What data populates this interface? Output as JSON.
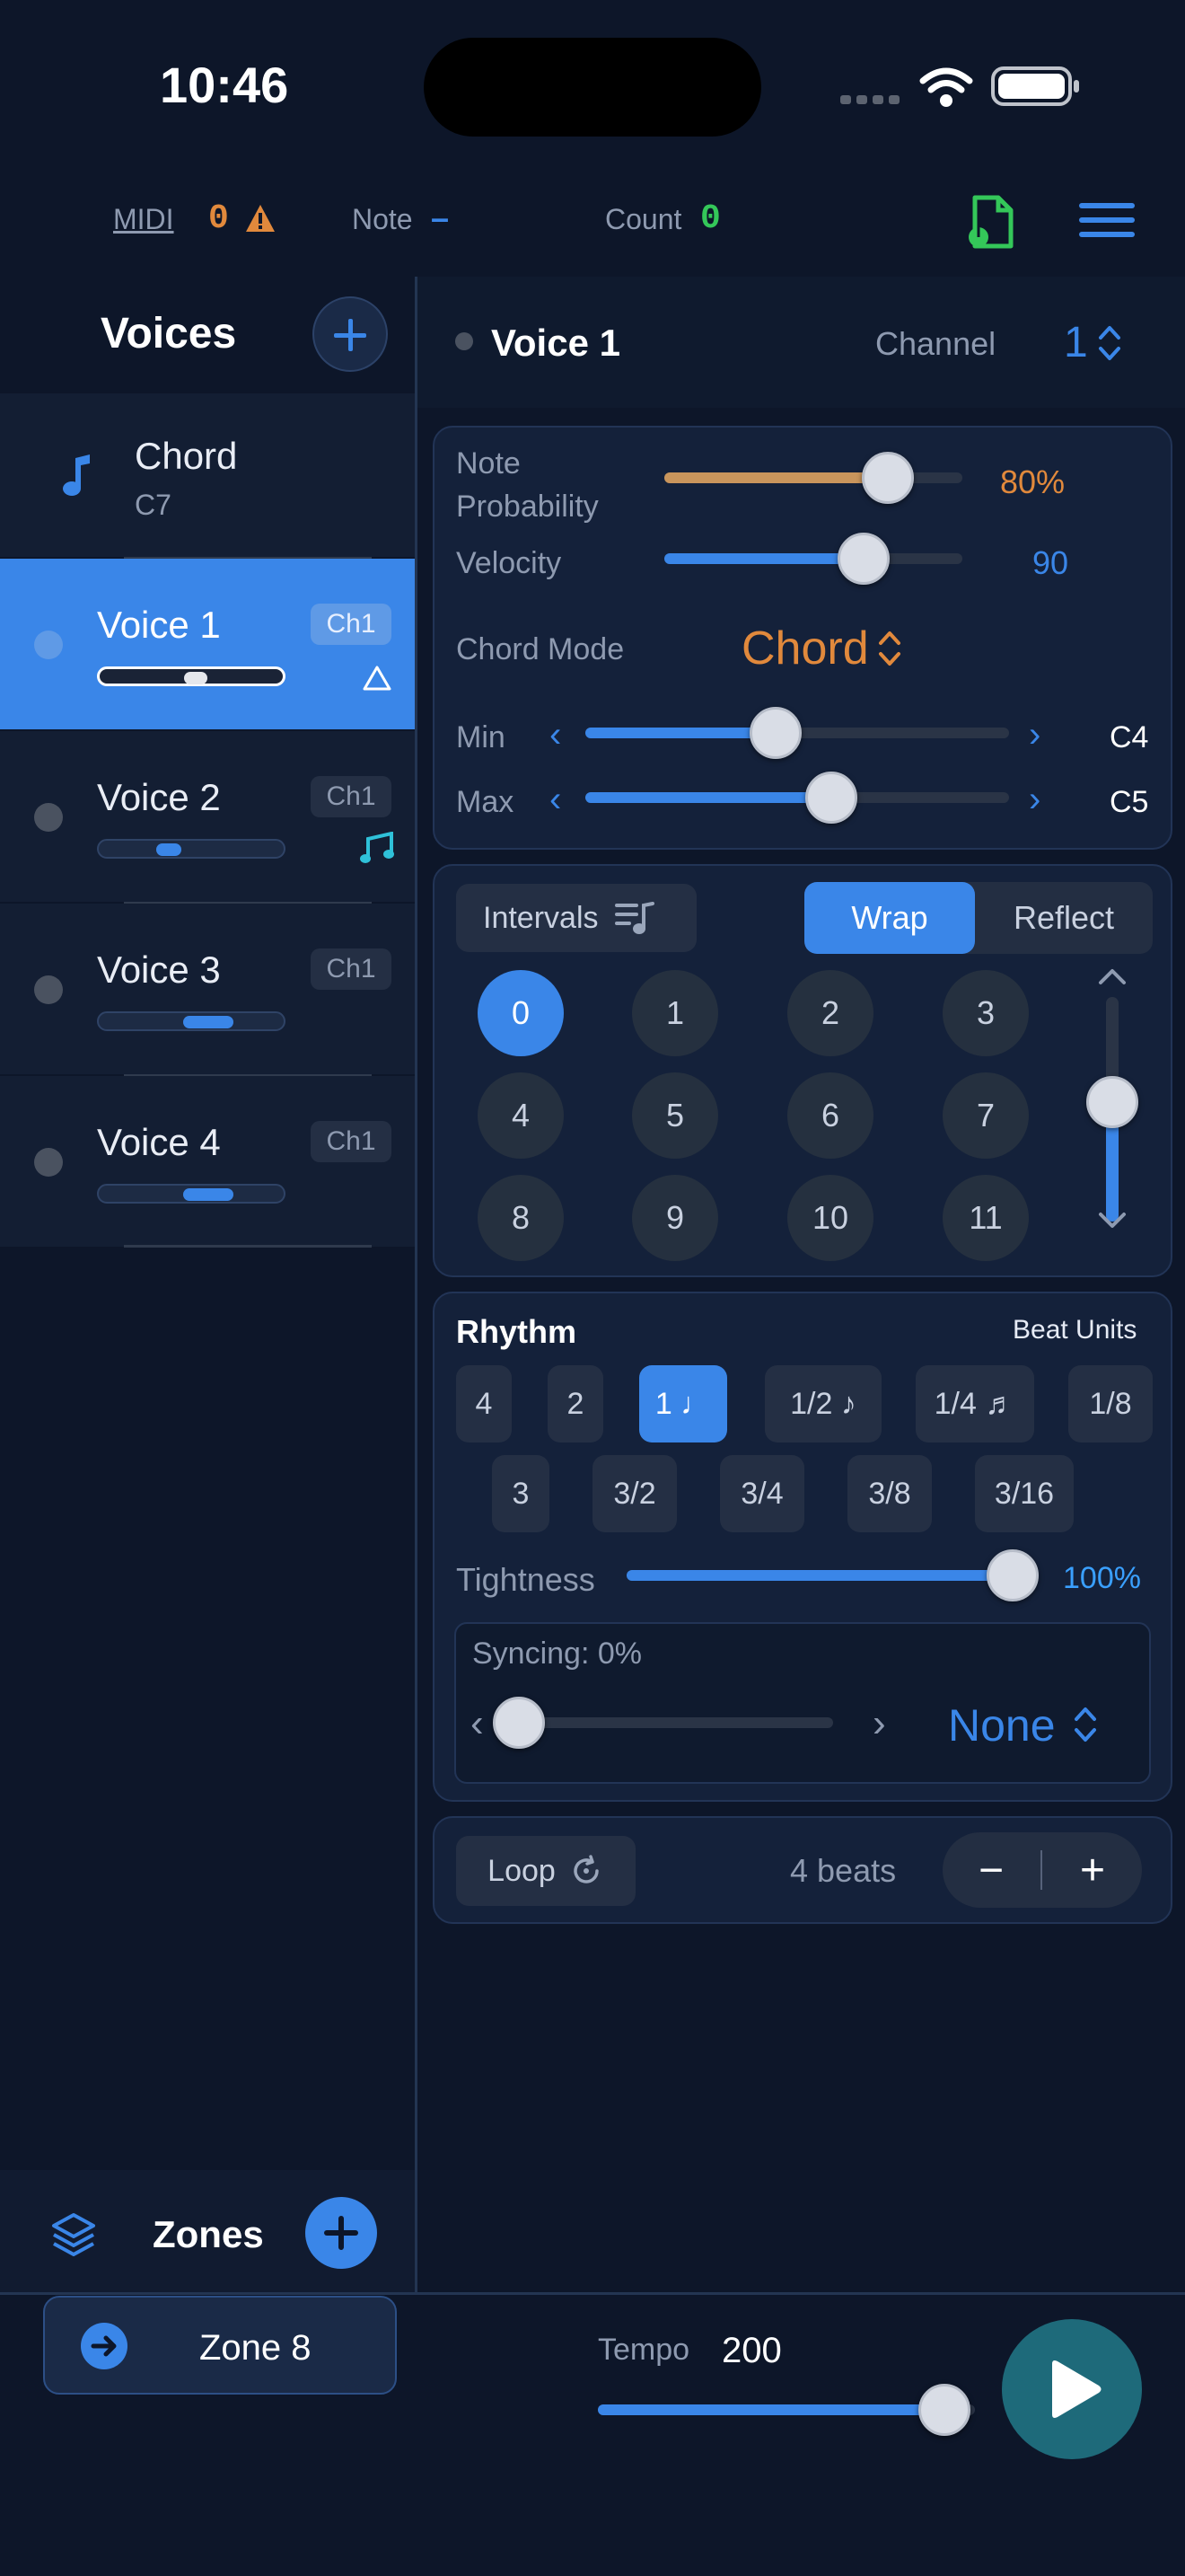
{
  "status_bar": {
    "time": "10:46"
  },
  "top_bar": {
    "midi_label": "MIDI",
    "midi_count": "0",
    "note_label": "Note",
    "note_value": "–",
    "count_label": "Count",
    "count_value": "0"
  },
  "sidebar": {
    "title": "Voices",
    "chord_item": {
      "title": "Chord",
      "subtitle": "C7"
    },
    "voices": [
      {
        "name": "Voice 1",
        "channel": "Ch1",
        "selected": true
      },
      {
        "name": "Voice 2",
        "channel": "Ch1",
        "selected": false
      },
      {
        "name": "Voice 3",
        "channel": "Ch1",
        "selected": false
      },
      {
        "name": "Voice 4",
        "channel": "Ch1",
        "selected": false
      }
    ],
    "zones_label": "Zones",
    "zone_button": "Zone 8"
  },
  "voice_header": {
    "title": "Voice 1",
    "channel_label": "Channel",
    "channel_value": "1"
  },
  "params": {
    "note_probability_label_1": "Note",
    "note_probability_label_2": "Probability",
    "note_probability_value": "80%",
    "note_probability_level": 0.75,
    "velocity_label": "Velocity",
    "velocity_value": "90",
    "velocity_level": 0.67,
    "chord_mode_label": "Chord Mode",
    "chord_mode_value": "Chord",
    "min_label": "Min",
    "min_value": "C4",
    "min_level": 0.45,
    "max_label": "Max",
    "max_value": "C5",
    "max_level": 0.58
  },
  "intervals": {
    "label": "Intervals",
    "wrap_label": "Wrap",
    "reflect_label": "Reflect",
    "numbers": [
      "0",
      "1",
      "2",
      "3",
      "4",
      "5",
      "6",
      "7",
      "8",
      "9",
      "10",
      "11"
    ],
    "selected": "0"
  },
  "rhythm": {
    "title": "Rhythm",
    "beat_units_label": "Beat Units",
    "row1": [
      "4",
      "2",
      "1 ♩",
      "1/2 ♪",
      "1/4 ♬",
      "1/8"
    ],
    "row2": [
      "3",
      "3/2",
      "3/4",
      "3/8",
      "3/16"
    ],
    "selected": "1 ♩",
    "tightness_label": "Tightness",
    "tightness_value": "100%",
    "tightness_level": 1.0,
    "syncing_label": "Syncing: 0%",
    "syncing_level": 0.0,
    "sync_mode_value": "None"
  },
  "loop": {
    "label": "Loop",
    "beats": "4 beats",
    "minus": "−",
    "plus": "+"
  },
  "transport": {
    "tempo_label": "Tempo",
    "tempo_value": "200",
    "tempo_level": 0.92
  },
  "colors": {
    "accent": "#3a86e8",
    "orange": "#e1893c",
    "green": "#34c759",
    "play": "#1e6a7a"
  }
}
